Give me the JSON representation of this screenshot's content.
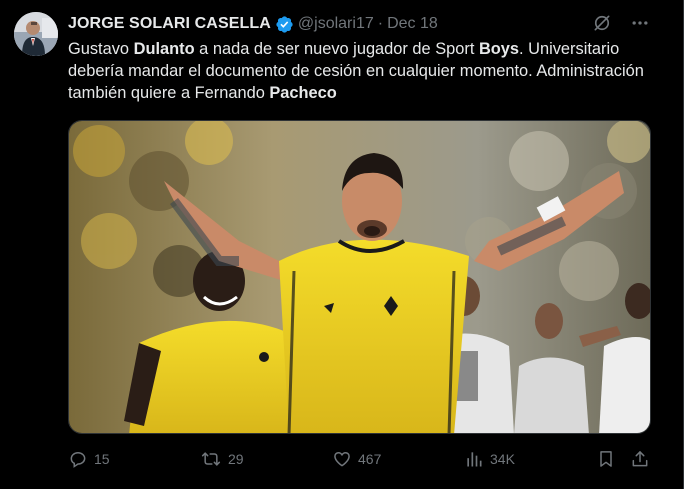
{
  "tweet": {
    "author_name": "JORGE SOLARI CASELLA",
    "handle": "@jsolari17",
    "separator": "·",
    "date": "Dec 18",
    "text_parts": [
      {
        "t": "Gustavo ",
        "b": false
      },
      {
        "t": "Dulanto",
        "b": true
      },
      {
        "t": " a nada de ser nuevo jugador de Sport ",
        "b": false
      },
      {
        "t": "Boys",
        "b": true
      },
      {
        "t": ". Universitario debería mandar el documento de cesión en cualquier momento. Administración también quiere a Fernando ",
        "b": false
      },
      {
        "t": "Pacheco",
        "b": true
      }
    ],
    "media_icon": "football-players-celebrating-photo",
    "actions": {
      "replies": "15",
      "reposts": "29",
      "likes": "467",
      "views": "34K"
    }
  },
  "colors": {
    "background": "#000000",
    "text": "#e7e9ea",
    "muted": "#71767b",
    "verified": "#1d9bf0",
    "border": "#2f3336"
  }
}
